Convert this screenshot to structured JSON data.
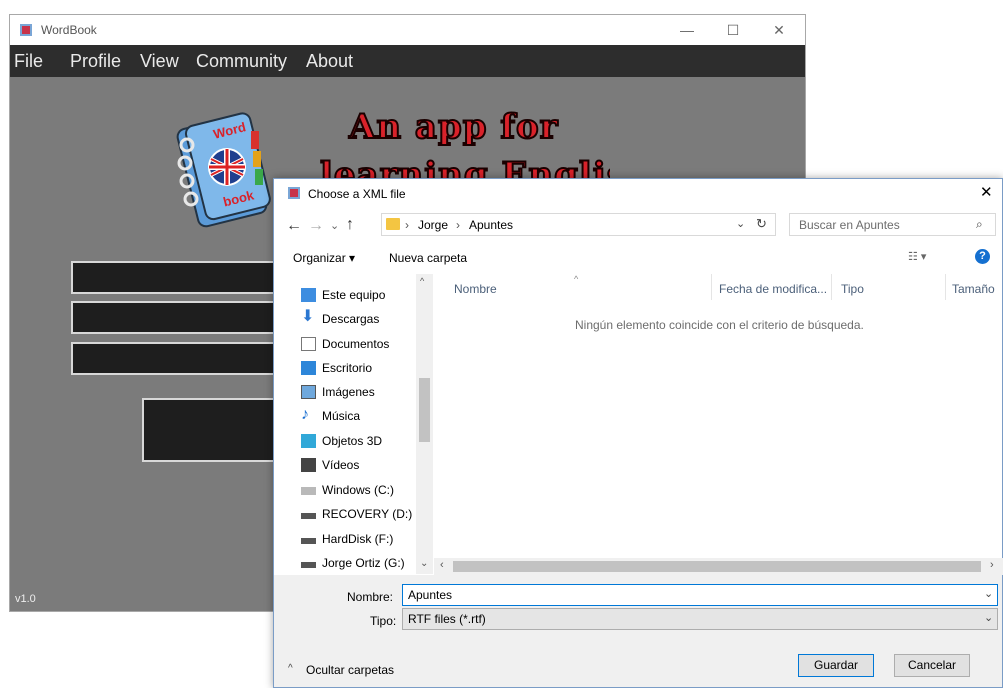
{
  "app": {
    "title": "WordBook",
    "menu": [
      "File",
      "Profile",
      "View",
      "Community",
      "About"
    ],
    "headline_line1": "An app for",
    "headline_line2": "learning English",
    "logo_text_top": "Word",
    "logo_text_bottom": "book",
    "version": "v1.0",
    "window_controls": {
      "minimize": "—",
      "maximize": "☐",
      "close": "✕"
    }
  },
  "dialog": {
    "title": "Choose a XML file",
    "close": "✕",
    "breadcrumb": [
      "Jorge",
      "Apuntes"
    ],
    "search_placeholder": "Buscar en Apuntes",
    "toolbar": {
      "organize": "Organizar ▾",
      "new_folder": "Nueva carpeta",
      "help": "?"
    },
    "columns": [
      "Nombre",
      "Fecha de modifica...",
      "Tipo",
      "Tamaño"
    ],
    "empty_message": "Ningún elemento coincide con el criterio de búsqueda.",
    "nav_items": [
      {
        "label": "Este equipo",
        "icon": "computer-icon"
      },
      {
        "label": "Descargas",
        "icon": "download-icon"
      },
      {
        "label": "Documentos",
        "icon": "document-icon"
      },
      {
        "label": "Escritorio",
        "icon": "desktop-icon"
      },
      {
        "label": "Imágenes",
        "icon": "pictures-icon"
      },
      {
        "label": "Música",
        "icon": "music-icon"
      },
      {
        "label": "Objetos 3D",
        "icon": "cube-icon"
      },
      {
        "label": "Vídeos",
        "icon": "video-icon"
      },
      {
        "label": "Windows (C:)",
        "icon": "windows-drive-icon"
      },
      {
        "label": "RECOVERY (D:)",
        "icon": "drive-icon"
      },
      {
        "label": "HardDisk (F:)",
        "icon": "drive-icon"
      },
      {
        "label": "Jorge Ortiz (G:)",
        "icon": "drive-icon"
      }
    ],
    "filename_label": "Nombre:",
    "filename_value": "Apuntes",
    "type_label": "Tipo:",
    "type_value": "RTF files (*.rtf)",
    "hide_folders": "Ocultar carpetas",
    "save_button": "Guardar",
    "cancel_button": "Cancelar"
  },
  "colors": {
    "accent": "#0078d7",
    "headline": "#d9222a",
    "app_bg": "#7b7b7b",
    "menubar": "#2d2d2d"
  }
}
